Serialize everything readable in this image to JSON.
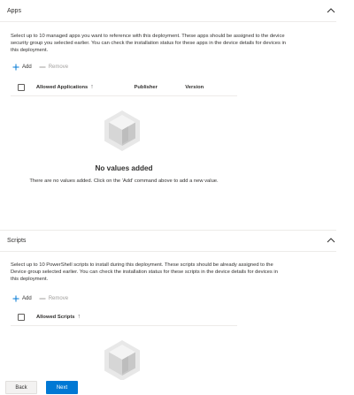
{
  "apps": {
    "title": "Apps",
    "description": "Select up to 10 managed apps you want to reference with this deployment. These apps should be assigned to the device security group you selected earlier. You can check the installation status for these apps in the device details for devices in this deployment.",
    "add_label": "Add",
    "remove_label": "Remove",
    "columns": [
      "Allowed Applications",
      "Publisher",
      "Version"
    ],
    "sort_arrow": "↑",
    "empty_title": "No values added",
    "empty_text": "There are no values added. Click on the 'Add' command above to add a new value."
  },
  "scripts": {
    "title": "Scripts",
    "description": "Select up to 10 PowerShell scripts to install during this deployment. These scripts should be already assigned to the Device group selected earlier. You can check the installation status for these scripts in the device details for devices in this deployment.",
    "add_label": "Add",
    "remove_label": "Remove",
    "columns": [
      "Allowed Scripts"
    ],
    "sort_arrow": "↑"
  },
  "footer": {
    "back_label": "Back",
    "next_label": "Next"
  },
  "colors": {
    "accent": "#0078d4",
    "disabled": "#a19f9d",
    "divider": "#edebe9"
  },
  "icons": {
    "collapse": "chevron-up-icon",
    "add": "plus-icon",
    "remove": "minus-icon",
    "empty": "hexagon-box-icon"
  }
}
